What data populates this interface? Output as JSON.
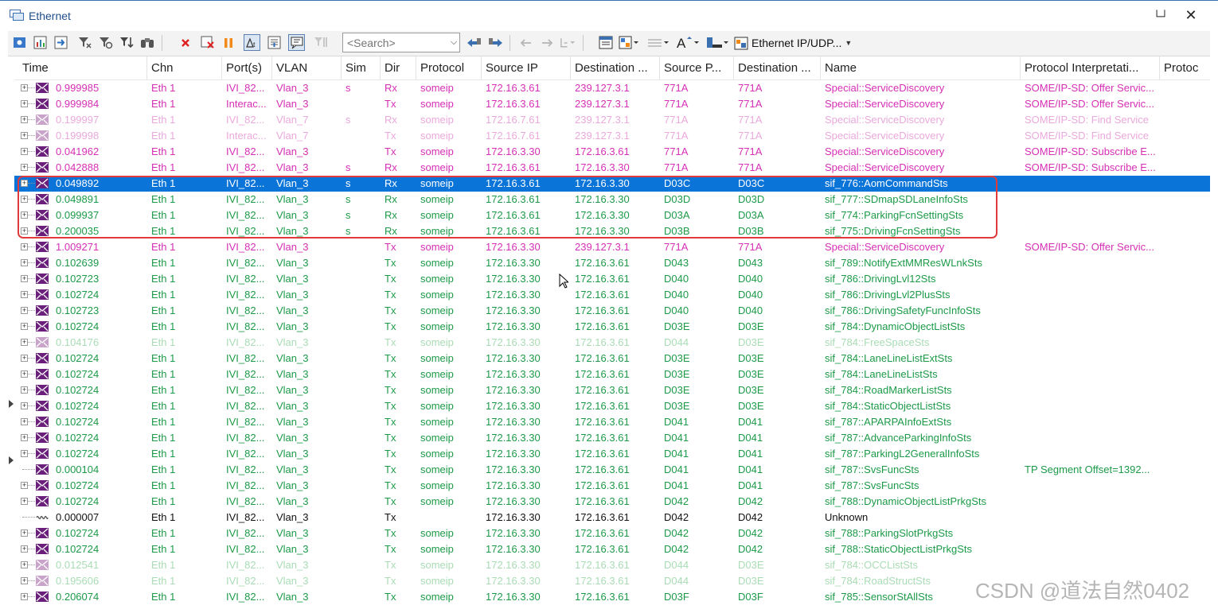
{
  "window": {
    "title": "Ethernet"
  },
  "toolbar": {
    "search_placeholder": "<Search>",
    "protocol_filter": "Ethernet IP/UDP..."
  },
  "columns": [
    "Time",
    "Chn",
    "Port(s)",
    "VLAN",
    "Sim",
    "Dir",
    "Protocol",
    "Source IP",
    "Destination ...",
    "Source P...",
    "Destination ...",
    "Name",
    "Protocol Interpretati...",
    "Protoc"
  ],
  "colors": {
    "magenta": "#d62fb5",
    "pink_faded": "#eaa9dc",
    "green": "#1c9a48",
    "green_faded": "#a9dcb5",
    "black": "#111111",
    "selected_bg": "#0a74d8",
    "highlight_border": "#e03a3a"
  },
  "rows": [
    {
      "time": "0.999985",
      "chn": "Eth 1",
      "port": "IVI_82...",
      "vlan": "Vlan_3",
      "sim": "s",
      "dir": "Rx",
      "protocol": "someip",
      "src_ip": "172.16.3.61",
      "dst_ip": "239.127.3.1",
      "src_port": "771A",
      "dst_port": "771A",
      "name": "Special::ServiceDiscovery",
      "interp": "SOME/IP-SD: Offer Servic...",
      "color": "magenta",
      "icon": "message-icon"
    },
    {
      "time": "0.999984",
      "chn": "Eth 1",
      "port": "Interac...",
      "vlan": "Vlan_3",
      "sim": "",
      "dir": "Tx",
      "protocol": "someip",
      "src_ip": "172.16.3.61",
      "dst_ip": "239.127.3.1",
      "src_port": "771A",
      "dst_port": "771A",
      "name": "Special::ServiceDiscovery",
      "interp": "SOME/IP-SD: Offer Servic...",
      "color": "magenta",
      "icon": "message-icon"
    },
    {
      "time": "0.199997",
      "chn": "Eth 1",
      "port": "IVI_82...",
      "vlan": "Vlan_7",
      "sim": "s",
      "dir": "Rx",
      "protocol": "someip",
      "src_ip": "172.16.7.61",
      "dst_ip": "239.127.3.1",
      "src_port": "771A",
      "dst_port": "771A",
      "name": "Special::ServiceDiscovery",
      "interp": "SOME/IP-SD: Find Service",
      "color": "pink_faded",
      "icon": "message-icon"
    },
    {
      "time": "0.199998",
      "chn": "Eth 1",
      "port": "Interac...",
      "vlan": "Vlan_7",
      "sim": "",
      "dir": "Tx",
      "protocol": "someip",
      "src_ip": "172.16.7.61",
      "dst_ip": "239.127.3.1",
      "src_port": "771A",
      "dst_port": "771A",
      "name": "Special::ServiceDiscovery",
      "interp": "SOME/IP-SD: Find Service",
      "color": "pink_faded",
      "icon": "message-icon"
    },
    {
      "time": "0.041962",
      "chn": "Eth 1",
      "port": "IVI_82...",
      "vlan": "Vlan_3",
      "sim": "",
      "dir": "Tx",
      "protocol": "someip",
      "src_ip": "172.16.3.30",
      "dst_ip": "172.16.3.61",
      "src_port": "771A",
      "dst_port": "771A",
      "name": "Special::ServiceDiscovery",
      "interp": "SOME/IP-SD: Subscribe E...",
      "color": "magenta",
      "icon": "message-icon"
    },
    {
      "time": "0.042888",
      "chn": "Eth 1",
      "port": "IVI_82...",
      "vlan": "Vlan_3",
      "sim": "s",
      "dir": "Rx",
      "protocol": "someip",
      "src_ip": "172.16.3.61",
      "dst_ip": "172.16.3.30",
      "src_port": "771A",
      "dst_port": "771A",
      "name": "Special::ServiceDiscovery",
      "interp": "SOME/IP-SD: Subscribe E...",
      "color": "magenta",
      "icon": "message-icon"
    },
    {
      "time": "0.049892",
      "chn": "Eth 1",
      "port": "IVI_82...",
      "vlan": "Vlan_3",
      "sim": "s",
      "dir": "Rx",
      "protocol": "someip",
      "src_ip": "172.16.3.61",
      "dst_ip": "172.16.3.30",
      "src_port": "D03C",
      "dst_port": "D03C",
      "name": "sif_776::AomCommandSts",
      "interp": "",
      "color": "green",
      "icon": "message-icon",
      "selected": true
    },
    {
      "time": "0.049891",
      "chn": "Eth 1",
      "port": "IVI_82...",
      "vlan": "Vlan_3",
      "sim": "s",
      "dir": "Rx",
      "protocol": "someip",
      "src_ip": "172.16.3.61",
      "dst_ip": "172.16.3.30",
      "src_port": "D03D",
      "dst_port": "D03D",
      "name": "sif_777::SDmapSDLaneInfoSts",
      "interp": "",
      "color": "green",
      "icon": "message-icon"
    },
    {
      "time": "0.099937",
      "chn": "Eth 1",
      "port": "IVI_82...",
      "vlan": "Vlan_3",
      "sim": "s",
      "dir": "Rx",
      "protocol": "someip",
      "src_ip": "172.16.3.61",
      "dst_ip": "172.16.3.30",
      "src_port": "D03A",
      "dst_port": "D03A",
      "name": "sif_774::ParkingFcnSettingSts",
      "interp": "",
      "color": "green",
      "icon": "message-icon"
    },
    {
      "time": "0.200035",
      "chn": "Eth 1",
      "port": "IVI_82...",
      "vlan": "Vlan_3",
      "sim": "s",
      "dir": "Rx",
      "protocol": "someip",
      "src_ip": "172.16.3.61",
      "dst_ip": "172.16.3.30",
      "src_port": "D03B",
      "dst_port": "D03B",
      "name": "sif_775::DrivingFcnSettingSts",
      "interp": "",
      "color": "green",
      "icon": "message-icon"
    },
    {
      "time": "1.009271",
      "chn": "Eth 1",
      "port": "IVI_82...",
      "vlan": "Vlan_3",
      "sim": "",
      "dir": "Tx",
      "protocol": "someip",
      "src_ip": "172.16.3.30",
      "dst_ip": "239.127.3.1",
      "src_port": "771A",
      "dst_port": "771A",
      "name": "Special::ServiceDiscovery",
      "interp": "SOME/IP-SD: Offer Servic...",
      "color": "magenta",
      "icon": "message-icon"
    },
    {
      "time": "0.102639",
      "chn": "Eth 1",
      "port": "IVI_82...",
      "vlan": "Vlan_3",
      "sim": "",
      "dir": "Tx",
      "protocol": "someip",
      "src_ip": "172.16.3.30",
      "dst_ip": "172.16.3.61",
      "src_port": "D043",
      "dst_port": "D043",
      "name": "sif_789::NotifyExtMMResWLnkSts",
      "interp": "",
      "color": "green",
      "icon": "message-icon"
    },
    {
      "time": "0.102723",
      "chn": "Eth 1",
      "port": "IVI_82...",
      "vlan": "Vlan_3",
      "sim": "",
      "dir": "Tx",
      "protocol": "someip",
      "src_ip": "172.16.3.30",
      "dst_ip": "172.16.3.61",
      "src_port": "D040",
      "dst_port": "D040",
      "name": "sif_786::DrivingLvl12Sts",
      "interp": "",
      "color": "green",
      "icon": "message-icon"
    },
    {
      "time": "0.102724",
      "chn": "Eth 1",
      "port": "IVI_82...",
      "vlan": "Vlan_3",
      "sim": "",
      "dir": "Tx",
      "protocol": "someip",
      "src_ip": "172.16.3.30",
      "dst_ip": "172.16.3.61",
      "src_port": "D040",
      "dst_port": "D040",
      "name": "sif_786::DrivingLvl2PlusSts",
      "interp": "",
      "color": "green",
      "icon": "message-icon"
    },
    {
      "time": "0.102723",
      "chn": "Eth 1",
      "port": "IVI_82...",
      "vlan": "Vlan_3",
      "sim": "",
      "dir": "Tx",
      "protocol": "someip",
      "src_ip": "172.16.3.30",
      "dst_ip": "172.16.3.61",
      "src_port": "D040",
      "dst_port": "D040",
      "name": "sif_786::DrivingSafetyFuncInfoSts",
      "interp": "",
      "color": "green",
      "icon": "message-icon"
    },
    {
      "time": "0.102724",
      "chn": "Eth 1",
      "port": "IVI_82...",
      "vlan": "Vlan_3",
      "sim": "",
      "dir": "Tx",
      "protocol": "someip",
      "src_ip": "172.16.3.30",
      "dst_ip": "172.16.3.61",
      "src_port": "D03E",
      "dst_port": "D03E",
      "name": "sif_784::DynamicObjectListSts",
      "interp": "",
      "color": "green",
      "icon": "message-icon"
    },
    {
      "time": "0.104176",
      "chn": "Eth 1",
      "port": "IVI_82...",
      "vlan": "Vlan_3",
      "sim": "",
      "dir": "Tx",
      "protocol": "someip",
      "src_ip": "172.16.3.30",
      "dst_ip": "172.16.3.61",
      "src_port": "D044",
      "dst_port": "D03E",
      "name": "sif_784::FreeSpaceSts",
      "interp": "",
      "color": "green_faded",
      "icon": "message-icon"
    },
    {
      "time": "0.102724",
      "chn": "Eth 1",
      "port": "IVI_82...",
      "vlan": "Vlan_3",
      "sim": "",
      "dir": "Tx",
      "protocol": "someip",
      "src_ip": "172.16.3.30",
      "dst_ip": "172.16.3.61",
      "src_port": "D03E",
      "dst_port": "D03E",
      "name": "sif_784::LaneLineListExtSts",
      "interp": "",
      "color": "green",
      "icon": "message-icon"
    },
    {
      "time": "0.102724",
      "chn": "Eth 1",
      "port": "IVI_82...",
      "vlan": "Vlan_3",
      "sim": "",
      "dir": "Tx",
      "protocol": "someip",
      "src_ip": "172.16.3.30",
      "dst_ip": "172.16.3.61",
      "src_port": "D03E",
      "dst_port": "D03E",
      "name": "sif_784::LaneLineListSts",
      "interp": "",
      "color": "green",
      "icon": "message-icon"
    },
    {
      "time": "0.102724",
      "chn": "Eth 1",
      "port": "IVI_82...",
      "vlan": "Vlan_3",
      "sim": "",
      "dir": "Tx",
      "protocol": "someip",
      "src_ip": "172.16.3.30",
      "dst_ip": "172.16.3.61",
      "src_port": "D03E",
      "dst_port": "D03E",
      "name": "sif_784::RoadMarkerListSts",
      "interp": "",
      "color": "green",
      "icon": "message-icon"
    },
    {
      "time": "0.102724",
      "chn": "Eth 1",
      "port": "IVI_82...",
      "vlan": "Vlan_3",
      "sim": "",
      "dir": "Tx",
      "protocol": "someip",
      "src_ip": "172.16.3.30",
      "dst_ip": "172.16.3.61",
      "src_port": "D03E",
      "dst_port": "D03E",
      "name": "sif_784::StaticObjectListSts",
      "interp": "",
      "color": "green",
      "icon": "message-icon"
    },
    {
      "time": "0.102724",
      "chn": "Eth 1",
      "port": "IVI_82...",
      "vlan": "Vlan_3",
      "sim": "",
      "dir": "Tx",
      "protocol": "someip",
      "src_ip": "172.16.3.30",
      "dst_ip": "172.16.3.61",
      "src_port": "D041",
      "dst_port": "D041",
      "name": "sif_787::APARPAInfoExtSts",
      "interp": "",
      "color": "green",
      "icon": "message-icon"
    },
    {
      "time": "0.102724",
      "chn": "Eth 1",
      "port": "IVI_82...",
      "vlan": "Vlan_3",
      "sim": "",
      "dir": "Tx",
      "protocol": "someip",
      "src_ip": "172.16.3.30",
      "dst_ip": "172.16.3.61",
      "src_port": "D041",
      "dst_port": "D041",
      "name": "sif_787::AdvanceParkingInfoSts",
      "interp": "",
      "color": "green",
      "icon": "message-icon"
    },
    {
      "time": "0.102724",
      "chn": "Eth 1",
      "port": "IVI_82...",
      "vlan": "Vlan_3",
      "sim": "",
      "dir": "Tx",
      "protocol": "someip",
      "src_ip": "172.16.3.30",
      "dst_ip": "172.16.3.61",
      "src_port": "D041",
      "dst_port": "D041",
      "name": "sif_787::ParkingL2GeneralInfoSts",
      "interp": "",
      "color": "green",
      "icon": "message-icon"
    },
    {
      "time": "0.000104",
      "chn": "Eth 1",
      "port": "IVI_82...",
      "vlan": "Vlan_3",
      "sim": "",
      "dir": "Tx",
      "protocol": "someip",
      "src_ip": "172.16.3.30",
      "dst_ip": "172.16.3.61",
      "src_port": "D041",
      "dst_port": "D041",
      "name": "sif_787::SvsFuncSts",
      "interp": "TP Segment Offset=1392...",
      "color": "green",
      "icon": "message-icon",
      "child": true
    },
    {
      "time": "0.102724",
      "chn": "Eth 1",
      "port": "IVI_82...",
      "vlan": "Vlan_3",
      "sim": "",
      "dir": "Tx",
      "protocol": "someip",
      "src_ip": "172.16.3.30",
      "dst_ip": "172.16.3.61",
      "src_port": "D041",
      "dst_port": "D041",
      "name": "sif_787::SvsFuncSts",
      "interp": "",
      "color": "green",
      "icon": "message-icon"
    },
    {
      "time": "0.102724",
      "chn": "Eth 1",
      "port": "IVI_82...",
      "vlan": "Vlan_3",
      "sim": "",
      "dir": "Tx",
      "protocol": "someip",
      "src_ip": "172.16.3.30",
      "dst_ip": "172.16.3.61",
      "src_port": "D042",
      "dst_port": "D042",
      "name": "sif_788::DynamicObjectListPrkgSts",
      "interp": "",
      "color": "green",
      "icon": "message-icon"
    },
    {
      "time": "0.000007",
      "chn": "Eth 1",
      "port": "IVI_82...",
      "vlan": "Vlan_3",
      "sim": "",
      "dir": "Tx",
      "protocol": "",
      "src_ip": "172.16.3.30",
      "dst_ip": "172.16.3.61",
      "src_port": "D042",
      "dst_port": "D042",
      "name": "Unknown",
      "interp": "",
      "color": "black",
      "icon": "wave-icon",
      "child": true
    },
    {
      "time": "0.102724",
      "chn": "Eth 1",
      "port": "IVI_82...",
      "vlan": "Vlan_3",
      "sim": "",
      "dir": "Tx",
      "protocol": "someip",
      "src_ip": "172.16.3.30",
      "dst_ip": "172.16.3.61",
      "src_port": "D042",
      "dst_port": "D042",
      "name": "sif_788::ParkingSlotPrkgSts",
      "interp": "",
      "color": "green",
      "icon": "message-icon"
    },
    {
      "time": "0.102724",
      "chn": "Eth 1",
      "port": "IVI_82...",
      "vlan": "Vlan_3",
      "sim": "",
      "dir": "Tx",
      "protocol": "someip",
      "src_ip": "172.16.3.30",
      "dst_ip": "172.16.3.61",
      "src_port": "D042",
      "dst_port": "D042",
      "name": "sif_788::StaticObjectListPrkgSts",
      "interp": "",
      "color": "green",
      "icon": "message-icon"
    },
    {
      "time": "0.012541",
      "chn": "Eth 1",
      "port": "IVI_82...",
      "vlan": "Vlan_3",
      "sim": "",
      "dir": "Tx",
      "protocol": "someip",
      "src_ip": "172.16.3.30",
      "dst_ip": "172.16.3.61",
      "src_port": "D044",
      "dst_port": "D03E",
      "name": "sif_784::OCCListSts",
      "interp": "",
      "color": "green_faded",
      "icon": "message-icon"
    },
    {
      "time": "0.195606",
      "chn": "Eth 1",
      "port": "IVI_82...",
      "vlan": "Vlan_3",
      "sim": "",
      "dir": "Tx",
      "protocol": "someip",
      "src_ip": "172.16.3.30",
      "dst_ip": "172.16.3.61",
      "src_port": "D044",
      "dst_port": "D03E",
      "name": "sif_784::RoadStructSts",
      "interp": "",
      "color": "green_faded",
      "icon": "message-icon"
    },
    {
      "time": "0.206074",
      "chn": "Eth 1",
      "port": "IVI_82...",
      "vlan": "Vlan_3",
      "sim": "",
      "dir": "Tx",
      "protocol": "someip",
      "src_ip": "172.16.3.30",
      "dst_ip": "172.16.3.61",
      "src_port": "D03F",
      "dst_port": "D03F",
      "name": "sif_785::SensorStAllSts",
      "interp": "",
      "color": "green",
      "icon": "message-icon"
    }
  ],
  "watermark": "CSDN @道法自然0402"
}
